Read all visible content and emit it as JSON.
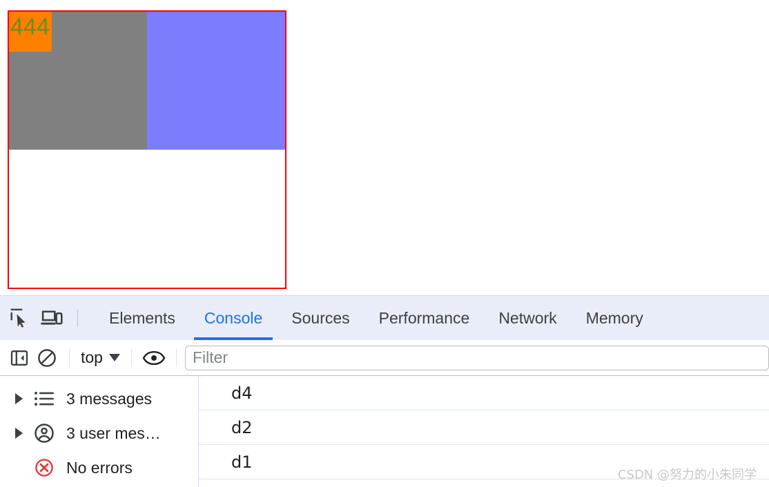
{
  "page": {
    "outer_container": {
      "name": "outer-box",
      "border_color": "#ff0000"
    },
    "boxes": [
      {
        "id": "d-gray",
        "label": "",
        "color": "#808080"
      },
      {
        "id": "d-purple",
        "label": "",
        "color": "#7b7dfd"
      }
    ],
    "orange_box": {
      "text": "444",
      "bg_color": "#ff8000",
      "text_color": "#6b8e23"
    }
  },
  "devtools": {
    "toolbar_icons": [
      {
        "name": "inspect-element-icon",
        "title": "Inspect"
      },
      {
        "name": "device-toolbar-icon",
        "title": "Toggle device toolbar"
      }
    ],
    "tabs": [
      {
        "label": "Elements",
        "active": false
      },
      {
        "label": "Console",
        "active": true
      },
      {
        "label": "Sources",
        "active": false
      },
      {
        "label": "Performance",
        "active": false
      },
      {
        "label": "Network",
        "active": false
      },
      {
        "label": "Memory",
        "active": false
      }
    ],
    "console_toolbar": {
      "sidebar_toggle": "show-console-sidebar",
      "clear_console": "clear-console",
      "context": "top",
      "eye_label": "create-live-expression",
      "filter_placeholder": "Filter",
      "filter_value": ""
    },
    "console_sidebar": [
      {
        "label": "3 messages",
        "icon": "list-icon",
        "expandable": true,
        "color": "#202124"
      },
      {
        "label": "3 user mes…",
        "icon": "user-icon",
        "expandable": true,
        "color": "#202124"
      },
      {
        "label": "No errors",
        "icon": "error-circle-icon",
        "expandable": false,
        "color": "#202124"
      }
    ],
    "console_messages": [
      {
        "text": "d4"
      },
      {
        "text": "d2"
      },
      {
        "text": "d1"
      }
    ]
  },
  "watermark": {
    "text": "CSDN @努力的小朱同学"
  },
  "colors": {
    "accent_blue": "#1a73e8",
    "tabbar_bg": "#e9edfa",
    "error_red": "#e53935",
    "border_gray": "#bdbdbd"
  }
}
